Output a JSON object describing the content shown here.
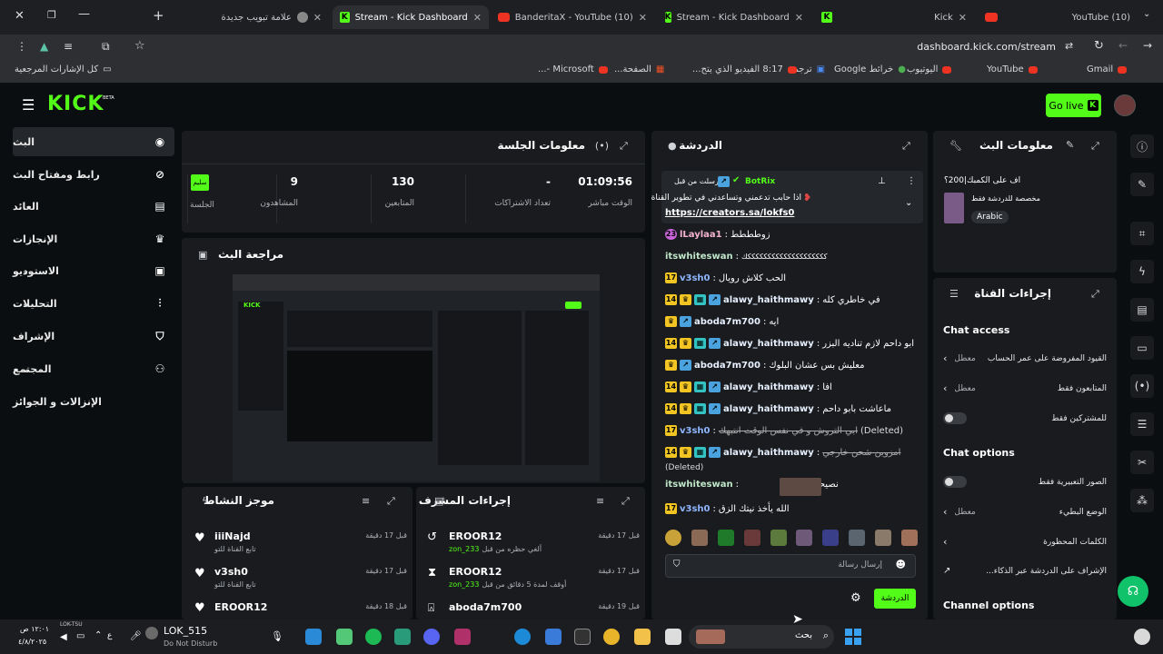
{
  "tabs": [
    {
      "label": "علامة تبويب جديدة"
    },
    {
      "label": "Stream - Kick Dashboard"
    },
    {
      "label": "(10) BanderitaX - YouTube"
    },
    {
      "label": "Stream - Kick Dashboard"
    },
    {
      "label": "Kick"
    },
    {
      "label": "(10) YouTube"
    }
  ],
  "address": {
    "url": "dashboard.kick.com/stream"
  },
  "bookmarks": {
    "all": "كل الإشارات المرجعية",
    "items": [
      "Gmail",
      "YouTube",
      "اليوتيوب",
      "خرائط Google",
      "ترجمة",
      "8:17 الفيديو الذي يتح...",
      "الصفحة...",
      "Microsoft -..."
    ]
  },
  "header": {
    "logo": "KICK",
    "beta": "BETA",
    "go_live": "Go live"
  },
  "sidebar": {
    "items": [
      {
        "label": "البث",
        "icon": "broadcast-icon"
      },
      {
        "label": "رابط ومفتاح البث",
        "icon": "key-icon"
      },
      {
        "label": "العائد",
        "icon": "wallet-icon"
      },
      {
        "label": "الإنجازات",
        "icon": "trophy-icon"
      },
      {
        "label": "الاستوديو",
        "icon": "studio-icon"
      },
      {
        "label": "التحليلات",
        "icon": "analytics-icon"
      },
      {
        "label": "الإشراف",
        "icon": "shield-icon"
      },
      {
        "label": "المجتمع",
        "icon": "community-icon"
      },
      {
        "label": "الإنزالات و الجوائز",
        "icon": "drops-icon"
      }
    ]
  },
  "session": {
    "title": "معلومات الجلسة",
    "stats": [
      {
        "value": "01:09:56",
        "label": "الوقت مباشر"
      },
      {
        "value": "-",
        "label": "تعداد الاشتراكات"
      },
      {
        "value": "130",
        "label": "المتابعين"
      },
      {
        "value": "9",
        "label": "المشاهدون"
      },
      {
        "value": "سليم",
        "label": "الجلسة"
      }
    ]
  },
  "preview": {
    "title": "مراجعة البث"
  },
  "activity": {
    "title": "موجز النشاط",
    "items": [
      {
        "user": "iiiNajd",
        "desc": "تابع القناة للتو",
        "time": "قبل 17 دقيقة"
      },
      {
        "user": "v3sh0",
        "desc": "تابع القناة للتو",
        "time": "قبل 17 دقيقة"
      },
      {
        "user": "EROOR12",
        "desc": "",
        "time": "قبل 18 دقيقة"
      }
    ]
  },
  "modactions": {
    "title": "إجراءات المشرف",
    "items": [
      {
        "user": "EROOR12",
        "desc": "ألغي حظره من قبل",
        "by": "zon_233",
        "time": "قبل 17 دقيقة"
      },
      {
        "user": "EROOR12",
        "desc": "أوقف لمدة 5 دقائق من قبل",
        "by": "zon_233",
        "time": "قبل 17 دقيقة"
      },
      {
        "user": "aboda7m700",
        "desc": "",
        "by": "",
        "time": "قبل 19 دقيقة"
      }
    ]
  },
  "chat": {
    "title": "الدردشة",
    "pinned": {
      "by_label": "أرسلت من قبل",
      "author": "BotRix",
      "text": "اذا حابب تدعمني وتساعدني في تطوير القناة",
      "link": "https://creators.sa/lokfs0"
    },
    "messages": [
      {
        "user": "lLaylaa1",
        "text": "زوطططط"
      },
      {
        "user": "itswhiteswan",
        "text": "ككككككككككككككككككككك"
      },
      {
        "user": "v3sh0",
        "text": "الحب كلاش رويال"
      },
      {
        "user": "alawy_haithmawy",
        "text": "في خاطري كله"
      },
      {
        "user": "aboda7m700",
        "text": "ايه"
      },
      {
        "user": "alawy_haithmawy",
        "text": "ابو داحم لازم تناديه البزر"
      },
      {
        "user": "aboda7m700",
        "text": "معليش بس عشان البلوك"
      },
      {
        "user": "alawy_haithmawy",
        "text": "افا"
      },
      {
        "user": "alawy_haithmawy",
        "text": "ماعاشت بابو داحم"
      },
      {
        "user": "v3sh0",
        "text": "ابي التروش و في نفس الوقت انتبهك",
        "deleted": "(Deleted)"
      },
      {
        "user": "alawy_haithmawy",
        "text": "امزوين شحن خارجي",
        "deleted": "(Deleted)"
      },
      {
        "user": "itswhiteswan",
        "text": "نصيحه تروش"
      },
      {
        "user": "v3sh0",
        "text": "الله يأخذ نيتك الزق"
      }
    ],
    "input_placeholder": "إرسال رسالة",
    "send": "الدردشة"
  },
  "streaminfo": {
    "title": "معلومات البث",
    "stream_title": "اف على الكمبك|200؟",
    "subtitle": "مخصصة للدردشة فقط",
    "language": "Arabic"
  },
  "channelactions": {
    "title": "إجراءات القناة",
    "chat_access": "Chat access",
    "access_rows": [
      {
        "label": "القيود المفروضة على عمر الحساب",
        "state": "معطل"
      },
      {
        "label": "المتابعون فقط",
        "state": "معطل"
      },
      {
        "label": "للمشتركين فقط",
        "state": ""
      }
    ],
    "chat_options": "Chat options",
    "option_rows": [
      {
        "label": "الصور التعبيرية فقط",
        "state": ""
      },
      {
        "label": "الوضع البطيء",
        "state": "معطل"
      },
      {
        "label": "الكلمات المحظورة",
        "state": ""
      },
      {
        "label": "الإشراف على الدردشة عبر الذكاء...",
        "state": ""
      }
    ],
    "channel_options": "Channel options"
  },
  "taskbar": {
    "time": "١٢:٠١ ص",
    "date": "٤/٨/٢٠٢٥",
    "tray_label": "LOK-TSU",
    "user": "LOK_515",
    "status": "Do Not Disturb",
    "search": "بحث"
  }
}
